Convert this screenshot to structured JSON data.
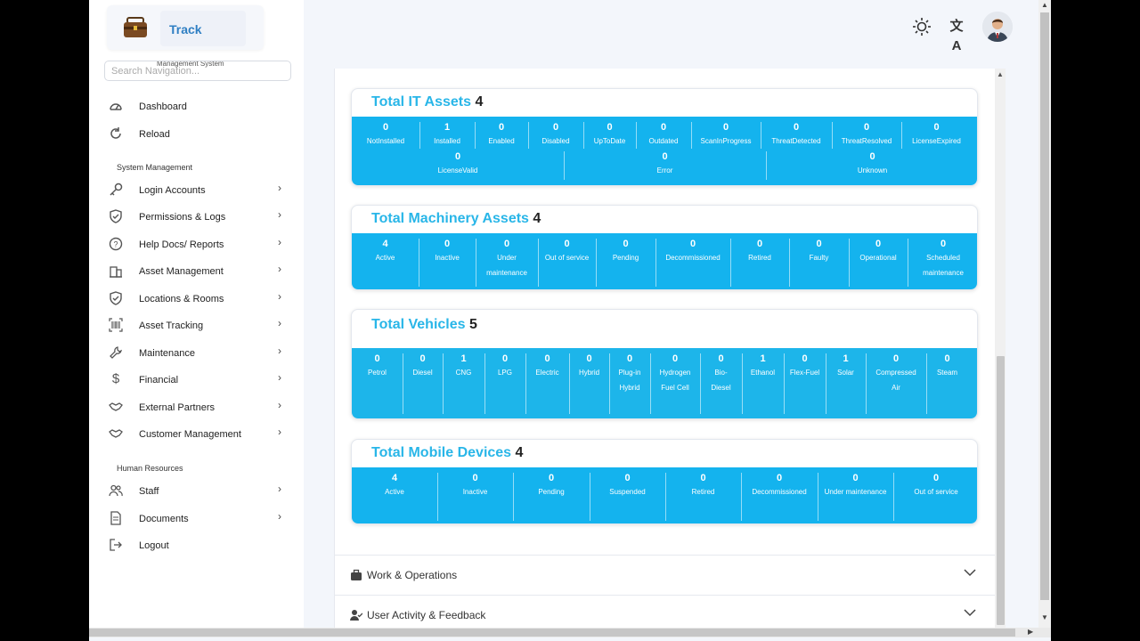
{
  "app": {
    "title": "Track",
    "subtitle": "Management System"
  },
  "search": {
    "placeholder": "Search Navigation..."
  },
  "sidebar": {
    "top_items": [
      {
        "label": "Dashboard",
        "icon": "dashboard-icon"
      },
      {
        "label": "Reload",
        "icon": "reload-icon"
      }
    ],
    "section_system": "System Management",
    "system_items": [
      {
        "label": "Login Accounts",
        "icon": "key-icon"
      },
      {
        "label": "Permissions & Logs",
        "icon": "shield-icon"
      },
      {
        "label": "Help Docs/ Reports",
        "icon": "help-icon"
      },
      {
        "label": "Asset Management",
        "icon": "building-icon"
      },
      {
        "label": "Locations & Rooms",
        "icon": "shield-check-icon"
      },
      {
        "label": "Asset Tracking",
        "icon": "barcode-icon"
      },
      {
        "label": "Maintenance",
        "icon": "wrench-icon"
      },
      {
        "label": "Financial",
        "icon": "dollar-icon"
      },
      {
        "label": "External Partners",
        "icon": "handshake-icon"
      },
      {
        "label": "Customer Management",
        "icon": "handshake-icon"
      }
    ],
    "section_hr": "Human Resources",
    "hr_items": [
      {
        "label": "Staff",
        "icon": "users-icon"
      },
      {
        "label": "Documents",
        "icon": "document-icon"
      }
    ],
    "logout": {
      "label": "Logout",
      "icon": "logout-icon"
    }
  },
  "topbar": {
    "icons": [
      "sun-icon",
      "translate-icon"
    ],
    "avatar": "user-avatar"
  },
  "cards": {
    "it": {
      "title": "Total IT Assets",
      "count": "4",
      "row1": [
        {
          "value": "0",
          "label": "NotInstalled"
        },
        {
          "value": "1",
          "label": "Installed"
        },
        {
          "value": "0",
          "label": "Enabled"
        },
        {
          "value": "0",
          "label": "Disabled"
        },
        {
          "value": "0",
          "label": "UpToDate"
        },
        {
          "value": "0",
          "label": "Outdated"
        },
        {
          "value": "0",
          "label": "ScanInProgress"
        },
        {
          "value": "0",
          "label": "ThreatDetected"
        },
        {
          "value": "0",
          "label": "ThreatResolved"
        },
        {
          "value": "0",
          "label": "LicenseExpired"
        }
      ],
      "row2": [
        {
          "value": "0",
          "label": "LicenseValid"
        },
        {
          "value": "0",
          "label": "Error"
        },
        {
          "value": "0",
          "label": "Unknown"
        }
      ]
    },
    "machinery": {
      "title": "Total Machinery Assets",
      "count": "4",
      "items": [
        {
          "value": "4",
          "label": "Active"
        },
        {
          "value": "0",
          "label": "Inactive"
        },
        {
          "value": "0",
          "label": "Under maintenance"
        },
        {
          "value": "0",
          "label": "Out of service"
        },
        {
          "value": "0",
          "label": "Pending"
        },
        {
          "value": "0",
          "label": "Decommissioned"
        },
        {
          "value": "0",
          "label": "Retired"
        },
        {
          "value": "0",
          "label": "Faulty"
        },
        {
          "value": "0",
          "label": "Operational"
        },
        {
          "value": "0",
          "label": "Scheduled maintenance"
        }
      ]
    },
    "vehicles": {
      "title": "Total Vehicles",
      "count": "5",
      "items": [
        {
          "value": "0",
          "label": "Petrol"
        },
        {
          "value": "0",
          "label": "Diesel"
        },
        {
          "value": "1",
          "label": "CNG"
        },
        {
          "value": "0",
          "label": "LPG"
        },
        {
          "value": "0",
          "label": "Electric"
        },
        {
          "value": "0",
          "label": "Hybrid"
        },
        {
          "value": "0",
          "label": "Plug-in Hybrid"
        },
        {
          "value": "0",
          "label": "Hydrogen Fuel Cell"
        },
        {
          "value": "0",
          "label": "Bio-Diesel"
        },
        {
          "value": "1",
          "label": "Ethanol"
        },
        {
          "value": "0",
          "label": "Flex-Fuel"
        },
        {
          "value": "1",
          "label": "Solar"
        },
        {
          "value": "0",
          "label": "Compressed Air"
        },
        {
          "value": "0",
          "label": "Steam"
        }
      ]
    },
    "mobile": {
      "title": "Total Mobile Devices",
      "count": "4",
      "items": [
        {
          "value": "4",
          "label": "Active"
        },
        {
          "value": "0",
          "label": "Inactive"
        },
        {
          "value": "0",
          "label": "Pending"
        },
        {
          "value": "0",
          "label": "Suspended"
        },
        {
          "value": "0",
          "label": "Retired"
        },
        {
          "value": "0",
          "label": "Decommissioned"
        },
        {
          "value": "0",
          "label": "Under maintenance"
        },
        {
          "value": "0",
          "label": "Out of service"
        }
      ]
    }
  },
  "accordions": [
    {
      "label": "Work & Operations",
      "icon": "briefcase-icon"
    },
    {
      "label": "User Activity & Feedback",
      "icon": "user-check-icon"
    }
  ],
  "colors": {
    "accent": "#14b3ee",
    "title": "#29b6e8"
  }
}
